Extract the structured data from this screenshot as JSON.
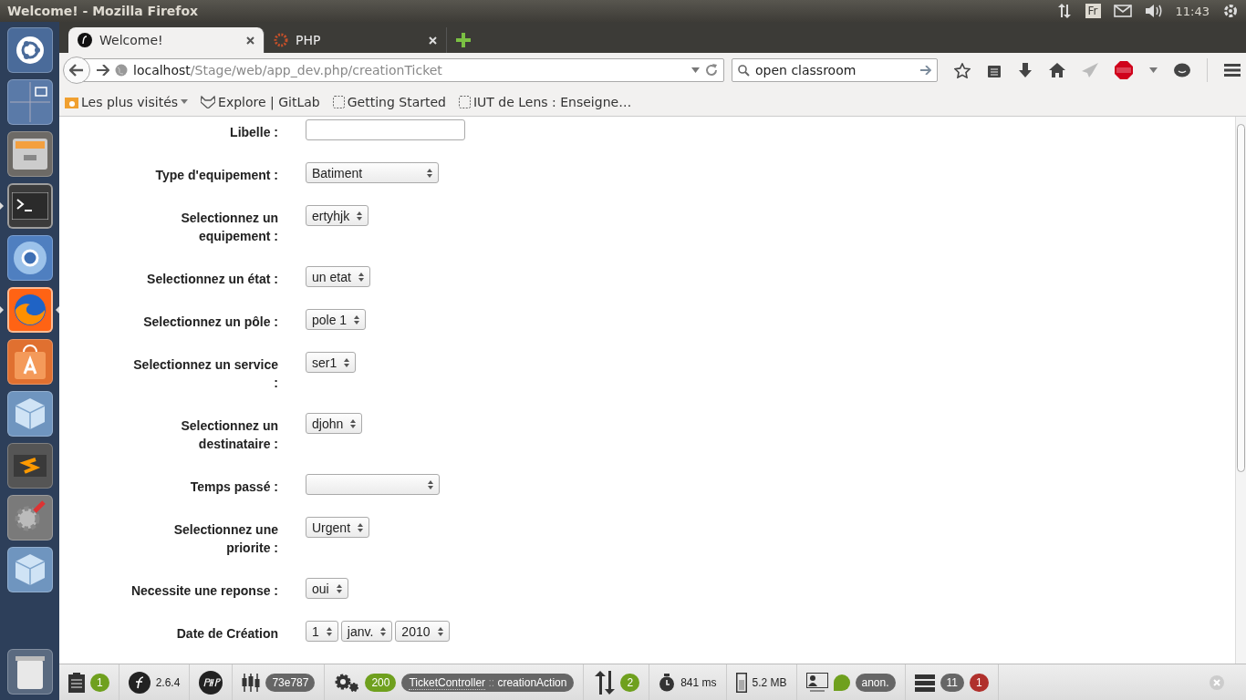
{
  "top_panel": {
    "title": "Welcome! - Mozilla Firefox",
    "keyboard": "Fr",
    "time": "11:43"
  },
  "launcher": [
    {
      "kind": "ubuntu",
      "running": false,
      "focused": false
    },
    {
      "kind": "workspaces",
      "running": false,
      "focused": false
    },
    {
      "kind": "files",
      "running": false,
      "focused": false
    },
    {
      "kind": "terminal",
      "running": true,
      "focused": false
    },
    {
      "kind": "chromium",
      "running": false,
      "focused": false
    },
    {
      "kind": "firefox",
      "running": true,
      "focused": true
    },
    {
      "kind": "store",
      "running": false,
      "focused": false
    },
    {
      "kind": "cube",
      "running": false,
      "focused": false
    },
    {
      "kind": "sublime",
      "running": false,
      "focused": false
    },
    {
      "kind": "settings",
      "running": false,
      "focused": false
    },
    {
      "kind": "cube",
      "running": false,
      "focused": false
    },
    {
      "kind": "trash",
      "running": false,
      "focused": false
    }
  ],
  "tabs": [
    {
      "title": "Welcome!",
      "kind": "symfony",
      "selected": true
    },
    {
      "title": "PHP",
      "kind": "php",
      "selected": false
    }
  ],
  "url": {
    "host": "localhost",
    "path": "/Stage/web/app_dev.php/creationTicket"
  },
  "search": {
    "value": "open classroom"
  },
  "bookmarks": [
    {
      "label": "Les plus visités",
      "kind": "folder"
    },
    {
      "label": "Explore | GitLab",
      "kind": "gitlab"
    },
    {
      "label": "Getting Started",
      "kind": "page"
    },
    {
      "label": "IUT de Lens : Enseigne…",
      "kind": "page"
    }
  ],
  "form": [
    {
      "label": "Libelle :",
      "kind": "text"
    },
    {
      "label": "Type d'equipement :",
      "kind": "select",
      "values": [
        "Batiment"
      ]
    },
    {
      "label": "Selectionnez un equipement :",
      "kind": "select",
      "values": [
        "ertyhjk"
      ]
    },
    {
      "label": "Selectionnez un état :",
      "kind": "select",
      "values": [
        "un etat"
      ]
    },
    {
      "label": "Selectionnez un pôle :",
      "kind": "select",
      "values": [
        "pole 1"
      ]
    },
    {
      "label": "Selectionnez un service :",
      "kind": "select",
      "values": [
        "ser1"
      ]
    },
    {
      "label": "Selectionnez un destinataire :",
      "kind": "select",
      "values": [
        "djohn"
      ]
    },
    {
      "label": "Temps passé :",
      "kind": "select"
    },
    {
      "label": "Selectionnez une priorite :",
      "kind": "select",
      "values": [
        "Urgent"
      ]
    },
    {
      "label": "Necessite une reponse :",
      "kind": "select",
      "values": [
        "oui"
      ]
    },
    {
      "label": "Date de Création",
      "kind": "select",
      "values": [
        "1",
        "janv.",
        "2010"
      ]
    }
  ],
  "debug_toolbar": [
    {
      "kind": "logs",
      "badges": [
        {
          "text": "1",
          "color": "#6fa01e"
        }
      ]
    },
    {
      "kind": "symfony",
      "text": "2.6.4"
    },
    {
      "kind": "php"
    },
    {
      "kind": "config",
      "badges": [
        {
          "text": "73e787",
          "color": "#666666"
        }
      ]
    },
    {
      "kind": "request",
      "badges": [
        {
          "text": "200",
          "color": "#6fa01e"
        }
      ],
      "controller": "TicketController",
      "separator": "::",
      "action": "creationAction"
    },
    {
      "kind": "ajax",
      "badges": [
        {
          "text": "2",
          "color": "#6fa01e"
        }
      ]
    },
    {
      "kind": "time",
      "text": "841 ms"
    },
    {
      "kind": "memory",
      "text": "5.2 MB"
    },
    {
      "kind": "security",
      "badges": [
        {
          "color": "#6fa01e"
        },
        {
          "text": "anon.",
          "color": "#666666"
        }
      ]
    },
    {
      "kind": "database",
      "badges": [
        {
          "text": "11",
          "color": "#666666"
        },
        {
          "text": "1",
          "color": "#b0302c"
        }
      ]
    }
  ]
}
